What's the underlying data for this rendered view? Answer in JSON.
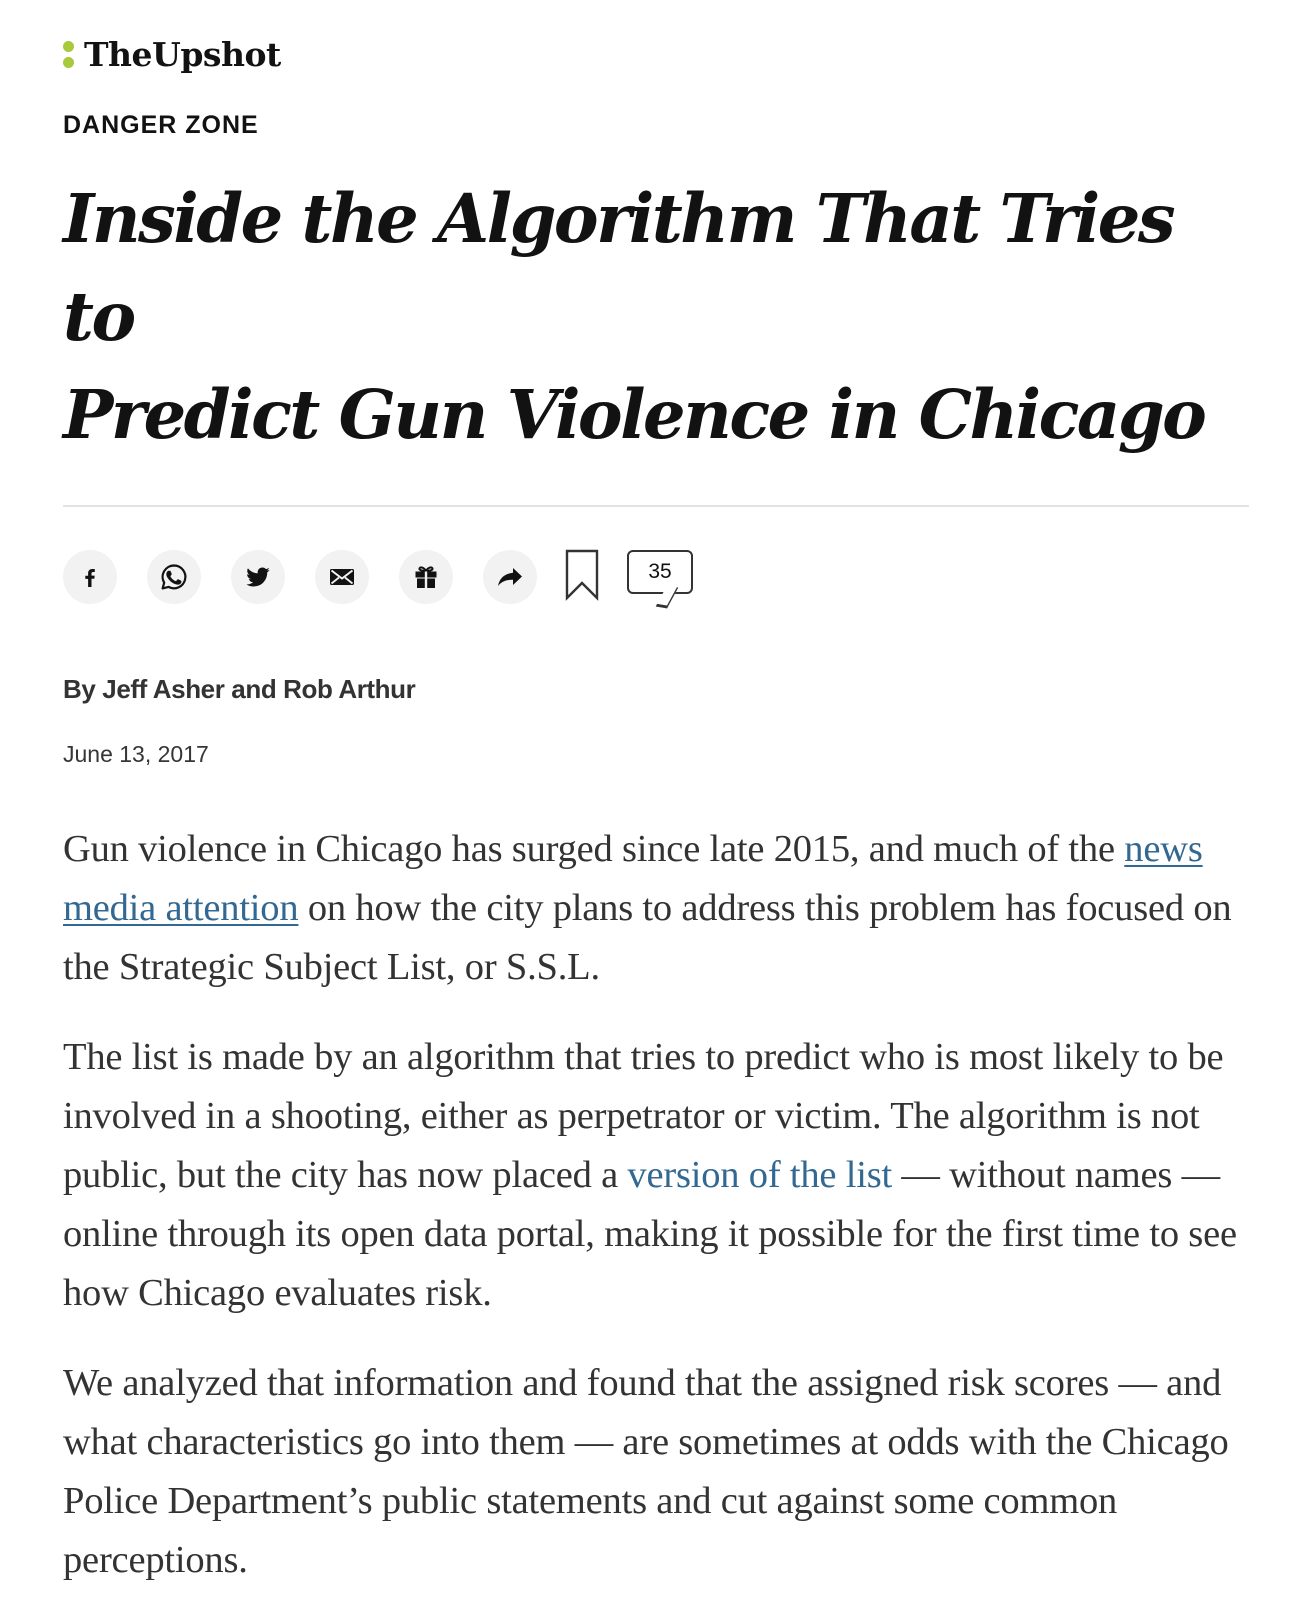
{
  "brand": {
    "name": "TheUpshot",
    "accent_color": "#a7c93b"
  },
  "article": {
    "kicker": "DANGER ZONE",
    "headline_line1": "Inside the Algorithm That Tries to",
    "headline_line2": "Predict Gun Violence in Chicago",
    "byline": "By Jeff Asher and Rob Arthur",
    "date": "June 13, 2017"
  },
  "toolbar": {
    "buttons": [
      {
        "name": "facebook",
        "icon": "facebook-icon"
      },
      {
        "name": "whatsapp",
        "icon": "whatsapp-icon"
      },
      {
        "name": "twitter",
        "icon": "twitter-icon"
      },
      {
        "name": "email",
        "icon": "email-icon"
      },
      {
        "name": "gift",
        "icon": "gift-icon"
      },
      {
        "name": "share",
        "icon": "share-arrow-icon"
      }
    ],
    "bookmark_icon": "bookmark-icon",
    "comment_count": "35"
  },
  "body": {
    "p1": {
      "before": "Gun violence in Chicago has surged since late 2015, and much of the ",
      "link": "news media attention",
      "after": " on how the city plans to address this problem has focused on the Strategic Subject List, or S.S.L."
    },
    "p2": {
      "before": "The list is made by an algorithm that tries to predict who is most likely to be involved in a shooting, either as perpetrator or victim. The algorithm is not public, but the city has now placed a ",
      "link": "version of the list",
      "after": " — without names — online through its open data portal, making it possible for the first time to see how Chicago evaluates risk."
    },
    "p3": {
      "text": "We analyzed that information and found that the assigned risk scores — and what characteristics go into them — are sometimes at odds with the Chicago Police Department’s public statements and cut against some common perceptions."
    },
    "link_color": "#326891"
  }
}
